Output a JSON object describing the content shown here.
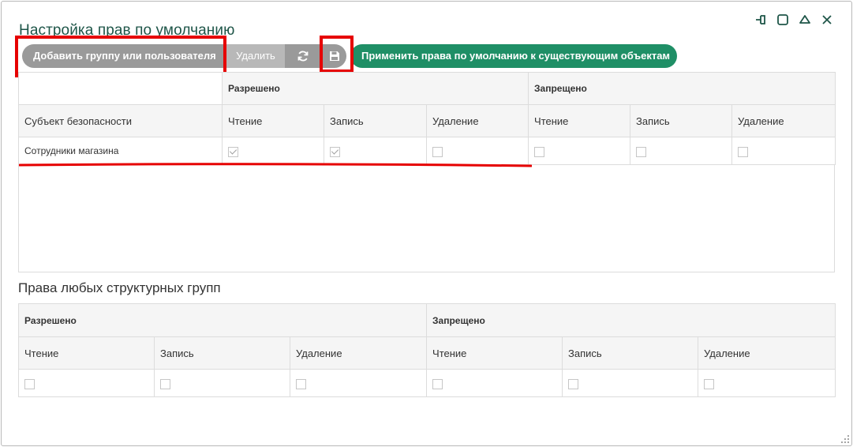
{
  "dialog": {
    "title": "Настройка прав по умолчанию",
    "controls": [
      "pin-icon",
      "maximize-icon",
      "collapse-icon",
      "close-icon"
    ]
  },
  "toolbar": {
    "add_label": "Добавить группу или пользователя",
    "delete_label": "Удалить",
    "refresh_icon": "refresh-icon",
    "save_icon": "save-icon",
    "apply_label": "Применить права по умолчанию к существующим объектам"
  },
  "table1": {
    "group_allowed": "Разрешено",
    "group_denied": "Запрещено",
    "subject_header": "Субъект безопасности",
    "cols": [
      "Чтение",
      "Запись",
      "Удаление",
      "Чтение",
      "Запись",
      "Удаление"
    ],
    "rows": [
      {
        "subject": "Сотрудники магазина",
        "checks": [
          true,
          true,
          false,
          false,
          false,
          false
        ]
      }
    ]
  },
  "section2": {
    "title": "Права любых структурных групп",
    "group_allowed": "Разрешено",
    "group_denied": "Запрещено",
    "cols": [
      "Чтение",
      "Запись",
      "Удаление",
      "Чтение",
      "Запись",
      "Удаление"
    ],
    "checks": [
      false,
      false,
      false,
      false,
      false,
      false
    ]
  },
  "colors": {
    "title": "#1e5548",
    "apply_button": "#1f8f66",
    "highlight": "#e60000",
    "toolbar_gray": "#9a9a9a"
  }
}
